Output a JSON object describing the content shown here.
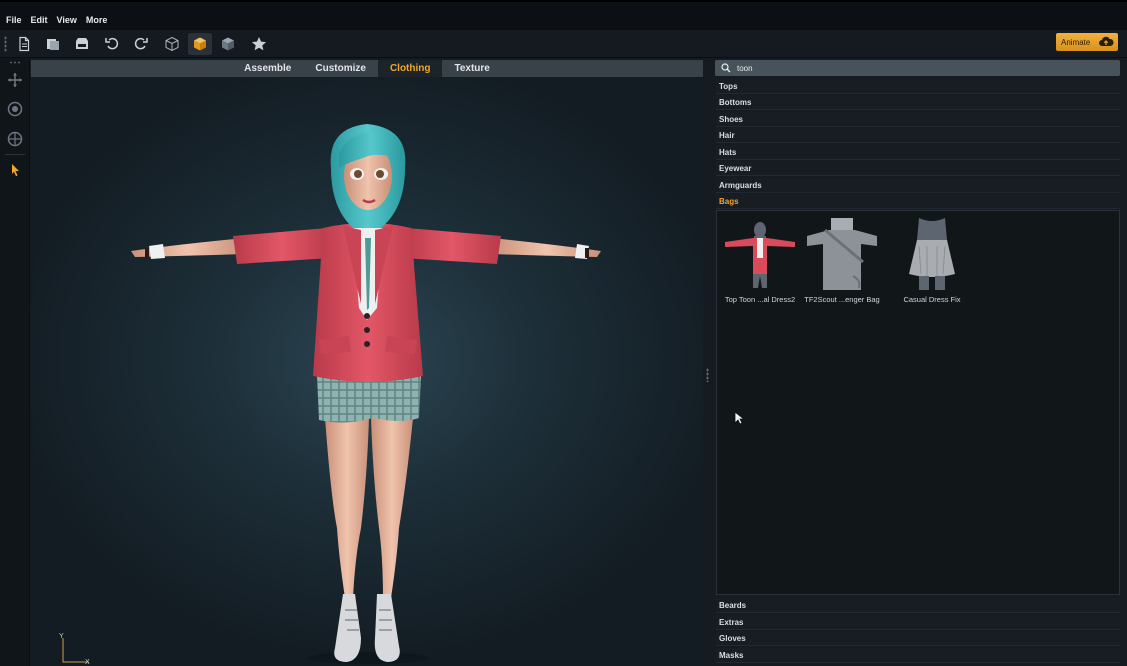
{
  "menu": [
    "File",
    "Edit",
    "View",
    "More"
  ],
  "toolbar": {
    "icons": [
      "new-document-icon",
      "open-icon",
      "save-icon",
      "undo-icon",
      "redo-icon",
      "box-outline-icon",
      "box-active-icon",
      "box-shaded-icon",
      "star-icon"
    ],
    "animate_label": "Animate"
  },
  "leftrail": {
    "icons": [
      "move-icon",
      "rotate-icon",
      "target-icon",
      "select-arrow-icon"
    ]
  },
  "viewport": {
    "tabs": [
      {
        "label": "Assemble",
        "active": false
      },
      {
        "label": "Customize",
        "active": false
      },
      {
        "label": "Clothing",
        "active": true
      },
      {
        "label": "Texture",
        "active": false
      }
    ],
    "axis": {
      "y": "Y",
      "x": "X"
    }
  },
  "panel": {
    "search_value": "toon",
    "categories_top": [
      {
        "label": "Tops",
        "active": false
      },
      {
        "label": "Bottoms",
        "active": false
      },
      {
        "label": "Shoes",
        "active": false
      },
      {
        "label": "Hair",
        "active": false
      },
      {
        "label": "Hats",
        "active": false
      },
      {
        "label": "Eyewear",
        "active": false
      },
      {
        "label": "Armguards",
        "active": false
      },
      {
        "label": "Bags",
        "active": true
      }
    ],
    "items": [
      {
        "name": "Top Toon ...al Dress2"
      },
      {
        "name": "TF2Scout ...enger Bag"
      },
      {
        "name": "Casual Dress Fix"
      }
    ],
    "categories_bottom": [
      {
        "label": "Beards"
      },
      {
        "label": "Extras"
      },
      {
        "label": "Gloves"
      },
      {
        "label": "Masks"
      }
    ]
  },
  "colors": {
    "accent": "#f0a72b",
    "jacket": "#d94a5a",
    "hair": "#3fb8bd"
  }
}
